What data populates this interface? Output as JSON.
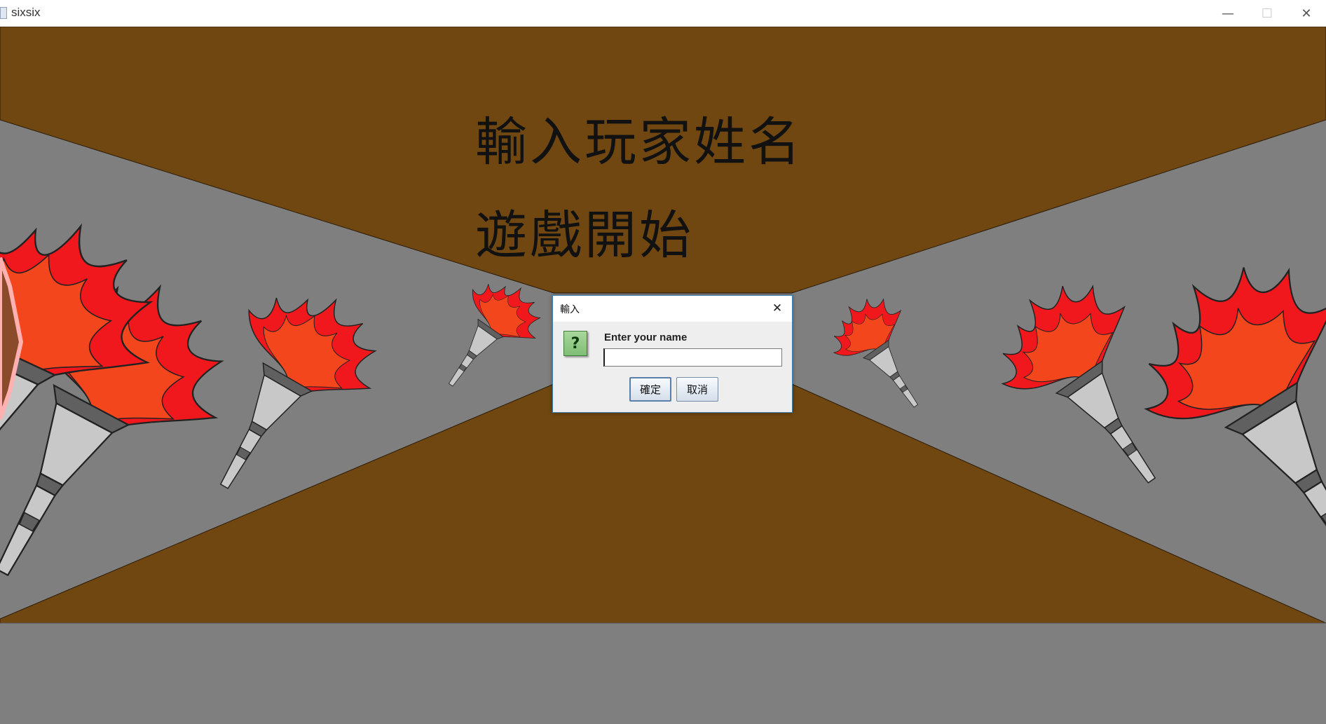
{
  "window": {
    "title": "sixsix",
    "minimize_glyph": "—",
    "maximize_glyph": "☐",
    "close_glyph": "✕"
  },
  "game": {
    "heading_line1": "輸入玩家姓名",
    "heading_line2": "遊戲開始",
    "colors": {
      "floor": "#7f7f7f",
      "wall": "#704711",
      "flame_red": "#f0181c",
      "flame_orange": "#f3461d",
      "torch_light": "#c8c8c8",
      "torch_dark": "#606060"
    }
  },
  "dialog": {
    "title": "輸入",
    "icon": "question-icon",
    "icon_glyph": "?",
    "prompt": "Enter your name",
    "input_value": "",
    "ok_label": "確定",
    "cancel_label": "取消"
  }
}
